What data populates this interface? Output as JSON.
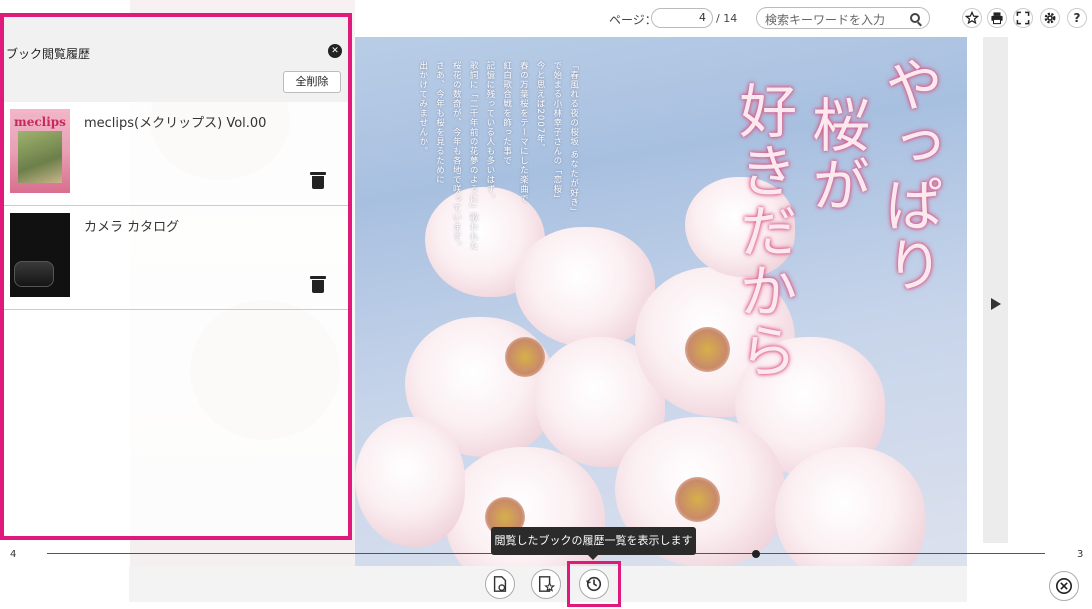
{
  "toolbar": {
    "page_label": "ページ：",
    "page_value": "4",
    "page_total": "/ 14",
    "search_placeholder": "検索キーワードを入力",
    "icons": [
      "star-icon",
      "print-icon",
      "fullscreen-icon",
      "gear-icon",
      "help-icon"
    ],
    "help_glyph": "?"
  },
  "history_panel": {
    "title": "ブック閲覧履歴",
    "clear_all_label": "全削除",
    "items": [
      {
        "title": "meclips(メクリップス) Vol.00",
        "thumb_logo": "meclips"
      },
      {
        "title": "カメラ カタログ"
      }
    ],
    "accent_color": "#e0197d"
  },
  "page": {
    "headline_cols": [
      "やっぱり",
      "桜が",
      "好きだから"
    ],
    "body_lines": [
      "「春風れる夜の桜坂 あなたが好き」",
      "で始まる小林幸子さんの「恋桜」",
      "今と思えば2007年。",
      "春の万葉桜をテーマにした楽曲で",
      "紅白歌合戦を飾った事で",
      "記憶に残っている人も多いはず。",
      "歌詞に「二千年前の花夢のように」歌われた",
      "桜花の数奇が、今年も各地で咲っています。",
      "さあ、今年も桜を見るために",
      "出かけてみませんか。"
    ]
  },
  "bottom_bar": {
    "slider_left": "4",
    "slider_right": "3",
    "slider_position": 0.71,
    "tooltip": "閲覧したブックの履歴一覧を表示します",
    "buttons": [
      "page-bookmark-icon",
      "bookmark-list-icon",
      "history-icon"
    ]
  }
}
